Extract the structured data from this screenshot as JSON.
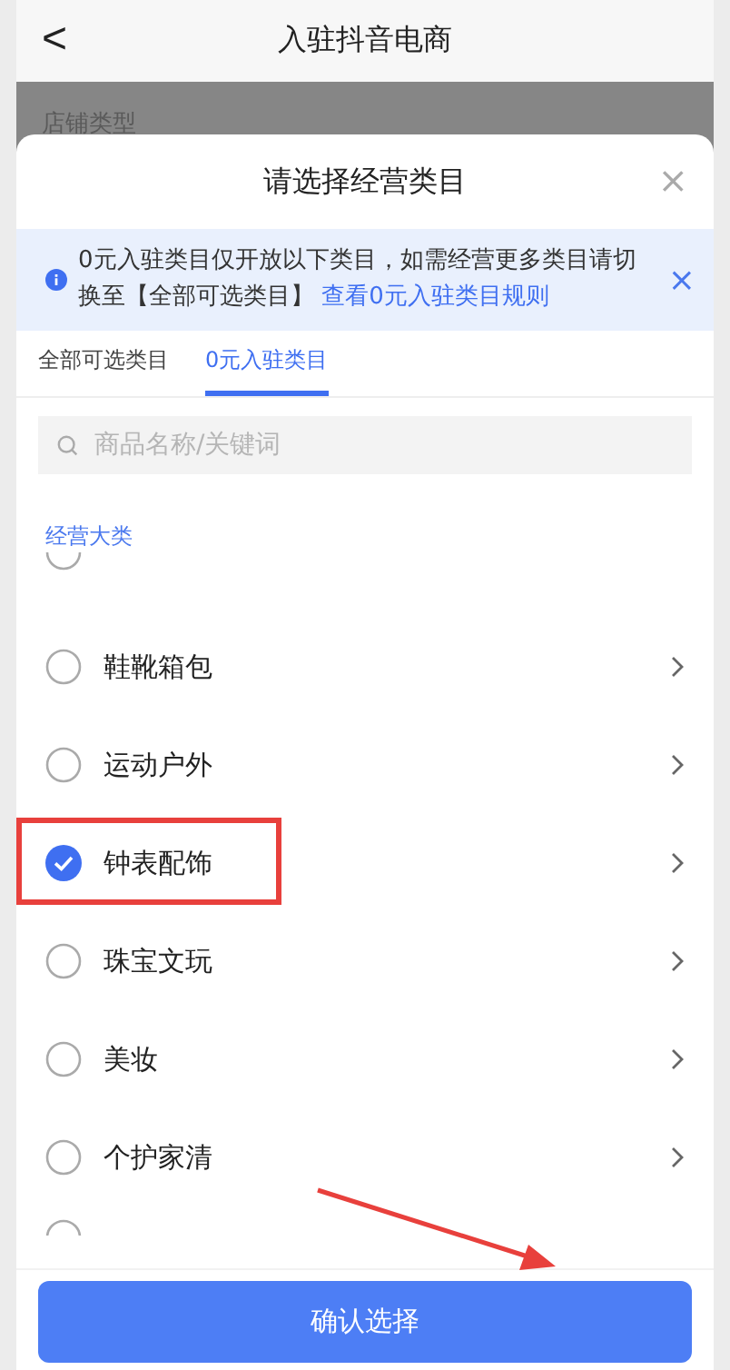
{
  "nav": {
    "back": "<",
    "title": "入驻抖音电商"
  },
  "behind": {
    "label": "店铺类型"
  },
  "sheet": {
    "title": "请选择经营类目",
    "close": "×"
  },
  "notice": {
    "text": "0元入驻类目仅开放以下类目，如需经营更多类目请切换至【全部可选类目】",
    "link": "查看0元入驻类目规则",
    "close": "×"
  },
  "tabs": [
    {
      "label": "全部可选类目",
      "selected": false
    },
    {
      "label": "0元入驻类目",
      "selected": true
    }
  ],
  "search": {
    "placeholder": "商品名称/关键词"
  },
  "section": "经营大类",
  "categories": [
    {
      "name": "鞋靴箱包",
      "checked": false
    },
    {
      "name": "运动户外",
      "checked": false
    },
    {
      "name": "钟表配饰",
      "checked": true
    },
    {
      "name": "珠宝文玩",
      "checked": false
    },
    {
      "name": "美妆",
      "checked": false
    },
    {
      "name": "个护家清",
      "checked": false
    }
  ],
  "confirm": "确认选择"
}
